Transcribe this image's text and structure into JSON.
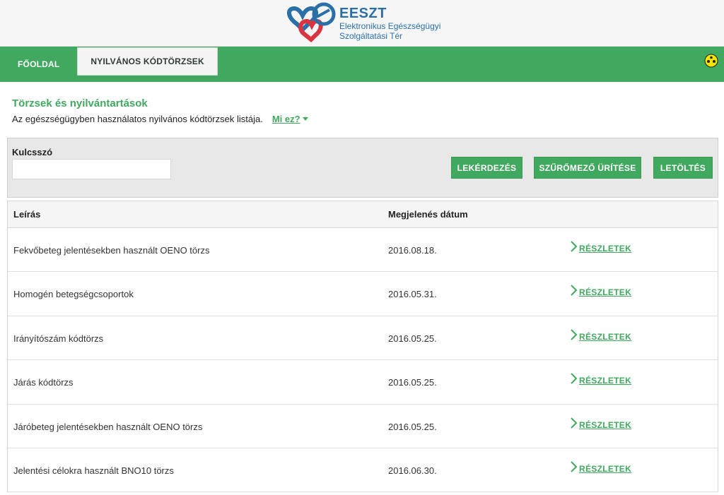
{
  "logo": {
    "title": "EESZT",
    "subtitle_line1": "Elektronikus Egészségügyi",
    "subtitle_line2": "Szolgáltatási Tér"
  },
  "nav": {
    "tabs": [
      {
        "label": "FŐOLDAL",
        "active": false
      },
      {
        "label": "NYILVÁNOS KÓDTÖRZSEK",
        "active": true
      }
    ]
  },
  "intro": {
    "title": "Törzsek és nyilvántartások",
    "description": "Az egészségügyben használatos nyilvános kódtörzsek listája.",
    "help_link": "Mi ez?"
  },
  "filter": {
    "keyword_label": "Kulcsszó",
    "keyword_value": "",
    "query_button": "LEKÉRDEZÉS",
    "clear_button": "SZŰRŐMEZŐ ÜRÍTÉSE",
    "download_button": "LETÖLTÉS"
  },
  "table": {
    "headers": {
      "description": "Leírás",
      "date": "Megjelenés dátum"
    },
    "rows": [
      {
        "description": "Fekvőbeteg jelentésekben használt OENO törzs",
        "date": "2016.08.18.",
        "link": "RÉSZLETEK"
      },
      {
        "description": "Homogén betegségcsoportok",
        "date": "2016.05.31.",
        "link": "RÉSZLETEK"
      },
      {
        "description": "Irányítószám kódtörzs",
        "date": "2016.05.25.",
        "link": "RÉSZLETEK"
      },
      {
        "description": "Járás kódtörzs",
        "date": "2016.05.25.",
        "link": "RÉSZLETEK"
      },
      {
        "description": "Járóbeteg jelentésekben használt OENO törzs",
        "date": "2016.05.25.",
        "link": "RÉSZLETEK"
      },
      {
        "description": "Jelentési célokra használt BNO10 törzs",
        "date": "2016.06.30.",
        "link": "RÉSZLETEK"
      }
    ]
  },
  "colors": {
    "brand_green": "#41a85f",
    "logo_blue": "#2a6fa8",
    "logo_red": "#d9343f"
  },
  "icons": {
    "accessibility": "accessibility-icon",
    "chevron": "chevron-right-icon",
    "dropdown": "caret-down-icon"
  }
}
